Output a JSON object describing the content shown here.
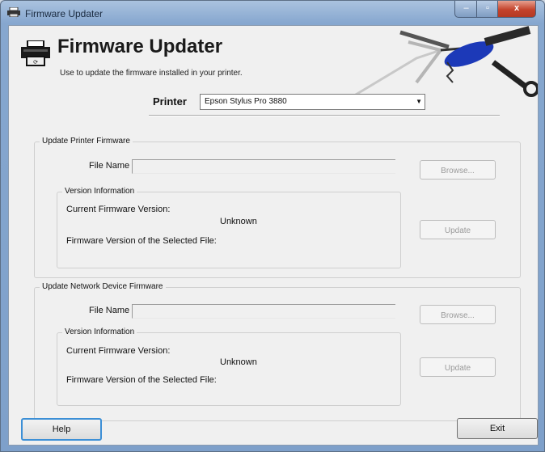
{
  "window": {
    "title": "Firmware Updater",
    "controls": {
      "minimize": "–",
      "maximize": "▫",
      "close": "x"
    }
  },
  "header": {
    "title": "Firmware Updater",
    "subtitle": "Use to update the firmware installed in your printer."
  },
  "printer": {
    "label": "Printer",
    "selected": "Epson Stylus Pro 3880"
  },
  "printer_firmware": {
    "legend": "Update Printer Firmware",
    "file_name_label": "File Name",
    "file_name_value": "",
    "browse_label": "Browse...",
    "version_info": {
      "legend": "Version Information",
      "current_label": "Current Firmware Version:",
      "current_value": "Unknown",
      "selected_label": "Firmware Version of the Selected File:"
    },
    "update_label": "Update"
  },
  "network_firmware": {
    "legend": "Update Network Device Firmware",
    "file_name_label": "File Name",
    "file_name_value": "",
    "browse_label": "Browse...",
    "version_info": {
      "legend": "Version Information",
      "current_label": "Current Firmware Version:",
      "current_value": "Unknown",
      "selected_label": "Firmware Version of the Selected File:"
    },
    "update_label": "Update"
  },
  "footer": {
    "help_label": "Help",
    "exit_label": "Exit"
  },
  "colors": {
    "title_bar": "#8fb0d6",
    "close_button": "#c4432c",
    "client_bg": "#f0f0f0",
    "focus_border": "#3c8fd6"
  }
}
